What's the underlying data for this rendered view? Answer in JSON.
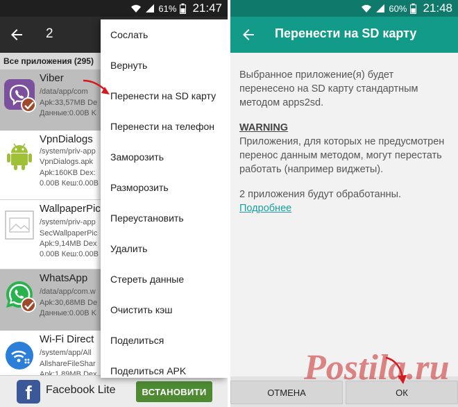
{
  "left": {
    "status": {
      "battery": "61%",
      "time": "21:47"
    },
    "appbar": {
      "count": "2"
    },
    "header": "Все приложения (295)",
    "apps": [
      {
        "name": "Viber",
        "line1": "/data/app/com",
        "line2": "Apk:33,57MB  De",
        "line3": "Данные:0.00B  K"
      },
      {
        "name": "VpnDialogs",
        "line1": "/system/priv-app",
        "line2": "VpnDialogs.apk",
        "line3": "Apk:160KB  Dex:",
        "line4": "0.00B  Кеш:0.00B"
      },
      {
        "name": "WallpaperPic",
        "line1": "/system/priv-app",
        "line2": "SecWallpaperPic",
        "line3": "Apk:9,14MB  Dex",
        "line4": "0.00B  Кеш:0.00B"
      },
      {
        "name": "WhatsApp",
        "line1": "/data/app/com.w",
        "line2": "Apk:30,68MB  De",
        "line3": "Данные:0.00B  K"
      },
      {
        "name": "Wi-Fi Direct",
        "line1": "/system/app/All",
        "line2": "AllshareFileShar",
        "line3": "Apk:1,89MB  Dex"
      }
    ],
    "menu": [
      "Сослать",
      "Вернуть",
      "Перенести на SD карту",
      "Перенести на телефон",
      "Заморозить",
      "Разморозить",
      "Переустановить",
      "Удалить",
      "Стереть данные",
      "Очистить кэш",
      "Поделиться",
      "Поделиться APK"
    ],
    "ad": {
      "logo": "f",
      "name": "Facebook Lite",
      "button": "ВСТАНОВИТИ"
    }
  },
  "right": {
    "status": {
      "battery": "60%",
      "time": "21:48"
    },
    "title": "Перенести на SD карту",
    "paragraph1": "Выбранное приложение(я) будет перенесено на SD карту стандартным методом apps2sd.",
    "warning_title": "WARNING",
    "warning_text": "Приложения, для которых не предусмотрен перенос данным методом, могут перестать работать (например виджеты).",
    "paragraph3": "2 приложения будут обработанны.",
    "more_link": "Подробнее",
    "cancel": "ОТМЕНА",
    "ok": "ОК"
  },
  "watermark": "Postila.ru",
  "colors": {
    "left_status": "#1f1f1f",
    "left_appbar": "#2b2b2b",
    "right_status": "#0f7a6c",
    "right_appbar": "#129b89",
    "link": "#1a9fa0",
    "ad_button": "#4d8a32",
    "arrow": "#d9161c"
  }
}
